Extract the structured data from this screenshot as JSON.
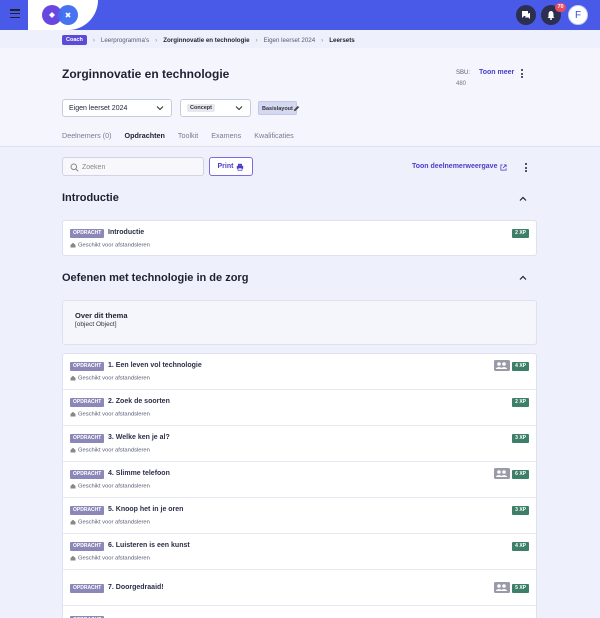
{
  "topbar": {
    "notification_count": "70",
    "avatar_initial": "F"
  },
  "breadcrumb": {
    "items": [
      "Coach",
      "Leerprogramma's",
      "Zorginnovatie en technologie",
      "Eigen leerset 2024",
      "Leersets"
    ]
  },
  "header": {
    "title": "Zorginnovatie en technologie",
    "sbu_label": "SBU:",
    "sbu_value": "480",
    "show_more": "Toon meer"
  },
  "filters": {
    "leerset": "Eigen leerset 2024",
    "status": "Concept",
    "layout": "Basislayout"
  },
  "tabs": [
    {
      "label": "Deelnemers (0)",
      "active": false
    },
    {
      "label": "Opdrachten",
      "active": true
    },
    {
      "label": "Toolkit",
      "active": false
    },
    {
      "label": "Examens",
      "active": false
    },
    {
      "label": "Kwalificaties",
      "active": false
    }
  ],
  "toolbar": {
    "search_placeholder": "Zoeken",
    "print_label": "Print",
    "participant_view": "Toon deelnemerweergave"
  },
  "sections": [
    {
      "title": "Introductie",
      "assignments": [
        {
          "type": "OPDRACHT",
          "title": "Introductie",
          "sub": "Geschikt voor afstandsleren",
          "xp": "2 XP",
          "group": false
        }
      ]
    },
    {
      "title": "Oefenen met technologie in de zorg",
      "theme": {
        "title": "Over dit thema",
        "body": "[object Object]"
      },
      "assignments": [
        {
          "type": "OPDRACHT",
          "title": "1. Een leven vol technologie",
          "sub": "Geschikt voor afstandsleren",
          "xp": "4 XP",
          "group": true
        },
        {
          "type": "OPDRACHT",
          "title": "2. Zoek de soorten",
          "sub": "Geschikt voor afstandsleren",
          "xp": "2 XP",
          "group": false
        },
        {
          "type": "OPDRACHT",
          "title": "3. Welke ken je al?",
          "sub": "Geschikt voor afstandsleren",
          "xp": "3 XP",
          "group": false
        },
        {
          "type": "OPDRACHT",
          "title": "4. Slimme telefoon",
          "sub": "Geschikt voor afstandsleren",
          "xp": "6 XP",
          "group": true
        },
        {
          "type": "OPDRACHT",
          "title": "5. Knoop het in je oren",
          "sub": "Geschikt voor afstandsleren",
          "xp": "3 XP",
          "group": false
        },
        {
          "type": "OPDRACHT",
          "title": "6. Luisteren is een kunst",
          "sub": "Geschikt voor afstandsleren",
          "xp": "4 XP",
          "group": false
        },
        {
          "type": "OPDRACHT",
          "title": "7. Doorgedraaid!",
          "sub": "",
          "xp": "5 XP",
          "group": true
        },
        {
          "type": "OPDRACHT",
          "title": "",
          "sub": "",
          "xp": "",
          "group": false
        }
      ]
    }
  ],
  "colors": {
    "primary": "#4a5ae8",
    "accent": "#4a3dc9",
    "xp_badge": "#3e7f6a",
    "type_badge": "#8b87b8",
    "notification": "#e84b5c"
  }
}
